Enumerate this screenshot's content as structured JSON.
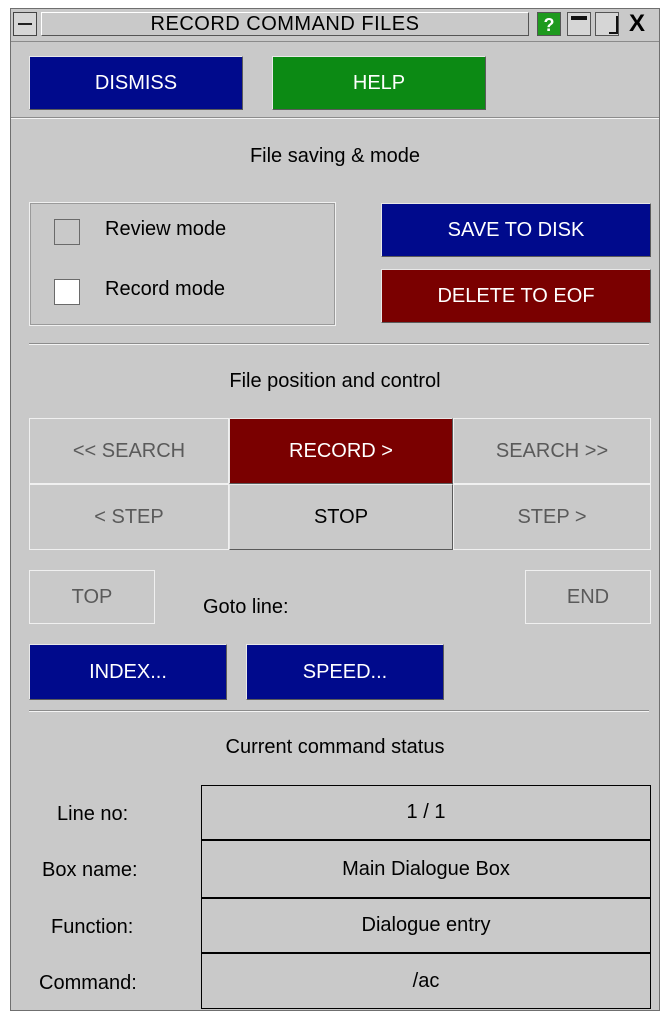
{
  "window": {
    "title": "RECORD COMMAND FILES",
    "help_glyph": "?",
    "close_glyph": "X"
  },
  "top_buttons": {
    "dismiss": "DISMISS",
    "help": "HELP"
  },
  "file_saving": {
    "heading": "File saving & mode",
    "review_mode": "Review mode",
    "record_mode": "Record mode",
    "save_to_disk": "SAVE TO DISK",
    "delete_to_eof": "DELETE TO EOF"
  },
  "file_position": {
    "heading": "File position and control",
    "search_back": "<< SEARCH",
    "record": "RECORD  >",
    "search_fwd": "SEARCH  >>",
    "step_back": "<  STEP",
    "stop": "STOP",
    "step_fwd": "STEP  >",
    "top": "TOP",
    "goto_line": "Goto line:",
    "end": "END",
    "index": "INDEX...",
    "speed": "SPEED..."
  },
  "status": {
    "heading": "Current command status",
    "rows": [
      {
        "label": "Line no:",
        "value": "1 /    1"
      },
      {
        "label": "Box name:",
        "value": "Main Dialogue Box"
      },
      {
        "label": "Function:",
        "value": "Dialogue entry"
      },
      {
        "label": "Command:",
        "value": "/ac"
      }
    ]
  },
  "colors": {
    "panel": "#c9c9c9",
    "blue_button": "#000a8c",
    "green_button": "#0c8a14",
    "red_button": "#7a0000",
    "help_icon": "#1e9a1e"
  },
  "icons": [
    "system-menu-icon",
    "help-icon",
    "minimize-icon",
    "maximize-icon",
    "close-icon"
  ]
}
